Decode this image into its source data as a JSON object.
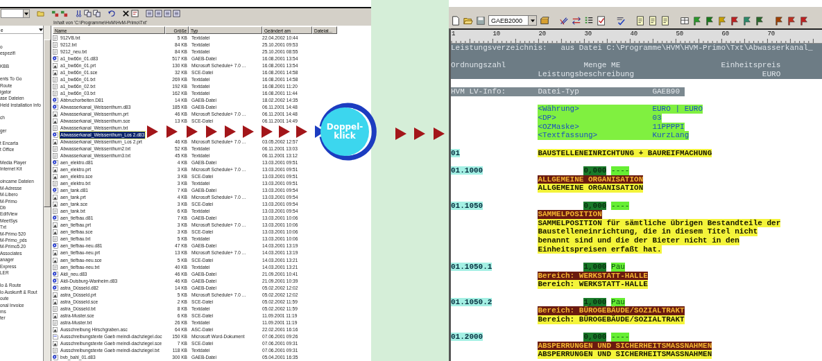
{
  "explorer": {
    "path_label": "Inhalt von 'C:\\Programme\\HvM\\HvM-Primo\\Txt'",
    "tree": {
      "header": "e",
      "groups": [
        [
          "o",
          "espezifi"
        ],
        [
          "KBB"
        ],
        [
          "ents To Go",
          "Route",
          "igator",
          "ase Dateien",
          "Held Installation Info"
        ],
        [
          "ch"
        ],
        [
          "ger"
        ],
        [
          "t Encarta",
          "t Office"
        ],
        [
          "Media Player",
          "Internet Kit"
        ],
        [
          "oincame Dateien",
          "M-Adresse",
          "M-Libero",
          "M-Primo",
          "Db",
          "EditView",
          "MeetSys",
          "Txt",
          "M-Primo 520",
          "M-Primo_pds",
          "M-Primo5.20",
          "Associates",
          "anager",
          "Express",
          "LER"
        ],
        [
          "lo & Route",
          "lo Auskunft & Rout",
          "oute",
          "onal Invoice",
          "ms",
          "ter"
        ]
      ]
    },
    "columns": [
      "Name",
      "Größe",
      "Typ",
      "Geändert am",
      "Dateiat..."
    ],
    "files": [
      {
        "name": "912VB.txt",
        "size": "5 KB",
        "type": "Textdatei",
        "date": "22.04.2002 10:44",
        "kind": "text",
        "selected": false
      },
      {
        "name": "9212.txt",
        "size": "84 KB",
        "type": "Textdatei",
        "date": "25.10.2001 09:53",
        "kind": "text",
        "selected": false
      },
      {
        "name": "9212_neu.txt",
        "size": "84 KB",
        "type": "Textdatei",
        "date": "25.10.2001 08:55",
        "kind": "text",
        "selected": false
      },
      {
        "name": "a1_bw66n_01.d83",
        "size": "517 KB",
        "type": "GAEB-Datei",
        "date": "16.08.2001 13:54",
        "kind": "gaeb",
        "selected": false
      },
      {
        "name": "a1_bw66n_01.prt",
        "size": "130 KB",
        "type": "Microsoft Schedule+ 7.0 ...",
        "date": "16.08.2001 13:54",
        "kind": "schedule",
        "selected": false
      },
      {
        "name": "a1_bw66n_01.sce",
        "size": "32 KB",
        "type": "SCE-Datei",
        "date": "16.08.2001 14:58",
        "kind": "sce",
        "selected": false
      },
      {
        "name": "a1_bw66n_01.txt",
        "size": "269 KB",
        "type": "Textdatei",
        "date": "16.08.2001 14:58",
        "kind": "text",
        "selected": false
      },
      {
        "name": "a1_bw66n_02.txt",
        "size": "192 KB",
        "type": "Textdatei",
        "date": "16.08.2001 11:20",
        "kind": "text",
        "selected": false
      },
      {
        "name": "a1_bw66n_03.txt",
        "size": "162 KB",
        "type": "Textdatei",
        "date": "16.08.2001 11:44",
        "kind": "text",
        "selected": false
      },
      {
        "name": "Abbruchorbeiten.D81",
        "size": "14 KB",
        "type": "GAEB-Datei",
        "date": "18.02.2002 14:35",
        "kind": "gaeb",
        "selected": false
      },
      {
        "name": "Abwasserkanal_Weissenthurn.d83",
        "size": "185 KB",
        "type": "GAEB-Datei",
        "date": "06.11.2001 14:48",
        "kind": "gaeb",
        "selected": false
      },
      {
        "name": "Abwasserkanal_Weissenthurn.prt",
        "size": "46 KB",
        "type": "Microsoft Schedule+ 7.0 ...",
        "date": "06.11.2001 14:48",
        "kind": "schedule",
        "selected": false
      },
      {
        "name": "Abwasserkanal_Weissenthurn.sce",
        "size": "13 KB",
        "type": "SCE-Datei",
        "date": "06.11.2001 14:49",
        "kind": "sce",
        "selected": false
      },
      {
        "name": "Abwasserkanal_Weissenthurn.txt",
        "kind": "text",
        "selected": false
      },
      {
        "name": "Abwasserkanal_Weissenthurn_Los 2.d83",
        "kind": "gaeb",
        "selected": true
      },
      {
        "name": "Abwasserkanal_Weissenthurn_Los 2.prt",
        "size": "46 KB",
        "type": "Microsoft Schedule+ 7.0 ...",
        "date": "03.05.2002 12:57",
        "kind": "schedule",
        "selected": false
      },
      {
        "name": "Abwasserkanal_Weissenthurn2.txt",
        "size": "52 KB",
        "type": "Textdatei",
        "date": "06.11.2001 13:03",
        "kind": "text",
        "selected": false
      },
      {
        "name": "Abwasserkanal_Weissenthurn3.txt",
        "size": "45 KB",
        "type": "Textdatei",
        "date": "06.11.2001 13:12",
        "kind": "text",
        "selected": false
      },
      {
        "name": "aen_elektro.d81",
        "size": "4 KB",
        "type": "GAEB-Datei",
        "date": "13.03.2001 09:51",
        "kind": "gaeb",
        "selected": false
      },
      {
        "name": "aen_elektro.prt",
        "size": "3 KB",
        "type": "Microsoft Schedule+ 7.0 ...",
        "date": "13.03.2001 09:51",
        "kind": "schedule",
        "selected": false
      },
      {
        "name": "aen_elektro.sce",
        "size": "3 KB",
        "type": "SCE-Datei",
        "date": "13.03.2001 09:51",
        "kind": "sce",
        "selected": false
      },
      {
        "name": "aen_elektro.txt",
        "size": "3 KB",
        "type": "Textdatei",
        "date": "13.03.2001 09:51",
        "kind": "text",
        "selected": false
      },
      {
        "name": "aen_tank.d81",
        "size": "7 KB",
        "type": "GAEB-Datei",
        "date": "13.03.2001 09:54",
        "kind": "gaeb",
        "selected": false
      },
      {
        "name": "aen_tank.prt",
        "size": "4 KB",
        "type": "Microsoft Schedule+ 7.0 ...",
        "date": "13.03.2001 09:54",
        "kind": "schedule",
        "selected": false
      },
      {
        "name": "aen_tank.sce",
        "size": "3 KB",
        "type": "SCE-Datei",
        "date": "13.03.2001 09:54",
        "kind": "sce",
        "selected": false
      },
      {
        "name": "aen_tank.txt",
        "size": "6 KB",
        "type": "Textdatei",
        "date": "13.03.2001 09:54",
        "kind": "text",
        "selected": false
      },
      {
        "name": "aen_tiefbau.d81",
        "size": "7 KB",
        "type": "GAEB-Datei",
        "date": "13.03.2001 10:06",
        "kind": "gaeb",
        "selected": false
      },
      {
        "name": "aen_tiefbau.prt",
        "size": "3 KB",
        "type": "Microsoft Schedule+ 7.0 ...",
        "date": "13.03.2001 10:06",
        "kind": "schedule",
        "selected": false
      },
      {
        "name": "aen_tiefbau.sce",
        "size": "3 KB",
        "type": "SCE-Datei",
        "date": "13.03.2001 10:06",
        "kind": "sce",
        "selected": false
      },
      {
        "name": "aen_tiefbau.txt",
        "size": "5 KB",
        "type": "Textdatei",
        "date": "13.03.2001 10:06",
        "kind": "text",
        "selected": false
      },
      {
        "name": "aen_tiefbau-neu.d81",
        "size": "47 KB",
        "type": "GAEB-Datei",
        "date": "14.03.2001 13:19",
        "kind": "gaeb",
        "selected": false
      },
      {
        "name": "aen_tiefbau-neu.prt",
        "size": "13 KB",
        "type": "Microsoft Schedule+ 7.0 ...",
        "date": "14.03.2001 13:19",
        "kind": "schedule",
        "selected": false
      },
      {
        "name": "aen_tiefbau-neu.sce",
        "size": "5 KB",
        "type": "SCE-Datei",
        "date": "14.03.2001 13:21",
        "kind": "sce",
        "selected": false
      },
      {
        "name": "aen_tiefbau-neu.txt",
        "size": "40 KB",
        "type": "Textdatei",
        "date": "14.03.2001 13:21",
        "kind": "text",
        "selected": false
      },
      {
        "name": "Aldi_neu.d83",
        "size": "46 KB",
        "type": "GAEB-Datei",
        "date": "21.09.2001 10:41",
        "kind": "gaeb",
        "selected": false
      },
      {
        "name": "Aldi-Duisburg-Wanheim.d83",
        "size": "46 KB",
        "type": "GAEB-Datei",
        "date": "21.09.2001 10:39",
        "kind": "gaeb",
        "selected": false
      },
      {
        "name": "astra_Düsseld.d82",
        "size": "14 KB",
        "type": "GAEB-Datei",
        "date": "05.02.2002 12:02",
        "kind": "gaeb",
        "selected": false
      },
      {
        "name": "astra_Düsseld.prt",
        "size": "5 KB",
        "type": "Microsoft Schedule+ 7.0 ...",
        "date": "05.02.2002 12:02",
        "kind": "schedule",
        "selected": false
      },
      {
        "name": "astra_Düsseld.sce",
        "size": "2 KB",
        "type": "SCE-Datei",
        "date": "05.02.2002 11:59",
        "kind": "sce",
        "selected": false
      },
      {
        "name": "astra_Düsseld.txt",
        "size": "8 KB",
        "type": "Textdatei",
        "date": "05.02.2002 11:59",
        "kind": "text",
        "selected": false
      },
      {
        "name": "astra-Muster.sce",
        "size": "6 KB",
        "type": "SCE-Datei",
        "date": "11.09.2001 11:19",
        "kind": "sce",
        "selected": false
      },
      {
        "name": "astra-Muster.txt",
        "size": "26 KB",
        "type": "Textdatei",
        "date": "11.09.2001 11:19",
        "kind": "text",
        "selected": false
      },
      {
        "name": "Ausschreibung Hirschgraben.asc",
        "size": "64 KB",
        "type": "ASC-Datei",
        "date": "22.02.2001 16:16",
        "kind": "sce",
        "selected": false
      },
      {
        "name": "Ausschreibungstexte Gaeb meindl-dachziegel.doc",
        "size": "150 KB",
        "type": "Microsoft Word-Dokument",
        "date": "07.06.2001 09:26",
        "kind": "word",
        "selected": false
      },
      {
        "name": "Ausschreibungstexte Gaeb meindl-dachziegel.sce",
        "size": "7 KB",
        "type": "SCE-Datei",
        "date": "07.06.2001 09:31",
        "kind": "sce",
        "selected": false
      },
      {
        "name": "Ausschreibungstexte Gaeb meindl-dachziegel.txt",
        "size": "118 KB",
        "type": "Textdatei",
        "date": "07.06.2001 09:31",
        "kind": "text",
        "selected": false
      },
      {
        "name": "bvb_bahl_01.d83",
        "size": "300 KB",
        "type": "GAEB-Datei",
        "date": "05.04.2001 16:35",
        "kind": "gaeb",
        "selected": false
      }
    ]
  },
  "callout": {
    "label_lines": [
      "Doppel-",
      "klick"
    ]
  },
  "editor": {
    "format_combo": "GAEB2000",
    "ruler": [
      "1",
      "10",
      "20",
      "30",
      "40",
      "50",
      "60",
      "70"
    ],
    "header": {
      "title": "Leistungsverzeichnis:",
      "source": "aus Datei C:\\Programme\\HVM\\HVM-Primo\\Txt\\Abwasserkanal_",
      "col_oz": "Ordnungszahl",
      "col_qty": "Menge ME",
      "col_price": "Einheitspreis",
      "col_text": "Leistungsbeschreibung",
      "col_currency": "EURO"
    },
    "info": {
      "label": "HVM LV-Info:",
      "key": "Datei-Typ",
      "value": "GAEB90"
    },
    "settings": [
      {
        "key": "<Währung>",
        "value": "EURO | EURO"
      },
      {
        "key": "<DP>",
        "value": "03"
      },
      {
        "key": "<OZMaske>",
        "value": "11PPPPI"
      },
      {
        "key": "<Textfassung>",
        "value": "KurzLang"
      }
    ],
    "entries": [
      {
        "kind": "title",
        "oz": "01",
        "text": "BAUSTELLENEINRICHTUNG + BAUREIFMACHUNG"
      },
      {
        "kind": "position",
        "oz": "01.1000",
        "quantity": "0,000",
        "unit": "----",
        "short_text": "ALLGEMEINE ORGANISATION",
        "long_text": [
          "ALLGEMEINE ORGANISATION"
        ]
      },
      {
        "kind": "position",
        "oz": "01.1050",
        "quantity": "0,000",
        "unit": "----",
        "short_text": "SAMMELPOSITION",
        "long_text": [
          "SAMMELPOSITION für sämtliche übrigen Bestandteile der",
          "Baustelleneinrichtung, die in diesem Titel nicht",
          "benannt sind und die der Bieter nicht in den",
          "Einheitspreisen erfaßt hat."
        ]
      },
      {
        "kind": "position",
        "oz": "01.1050.1",
        "quantity": "1,000",
        "unit": "Pau",
        "short_text": "Bereich: WERKSTATT-HALLE",
        "long_text": [
          "Bereich: WERKSTATT-HALLE"
        ]
      },
      {
        "kind": "position",
        "oz": "01.1050.2",
        "quantity": "1,000",
        "unit": "Pau",
        "short_text": "Bereich: BÜROGEBÄUDE/SOZIALTRAKT",
        "long_text": [
          "Bereich: BÜROGEBÄUDE/SOZIALTRAKT"
        ]
      },
      {
        "kind": "position",
        "oz": "01.2000",
        "quantity": "0,000",
        "unit": "----",
        "short_text": "ABSPERRUNGEN UND SICHERHEITSMASSNAHMEN",
        "long_text": [
          "ABSPERRUNGEN UND SICHERHEITSMASSNAHMEN"
        ]
      }
    ]
  }
}
